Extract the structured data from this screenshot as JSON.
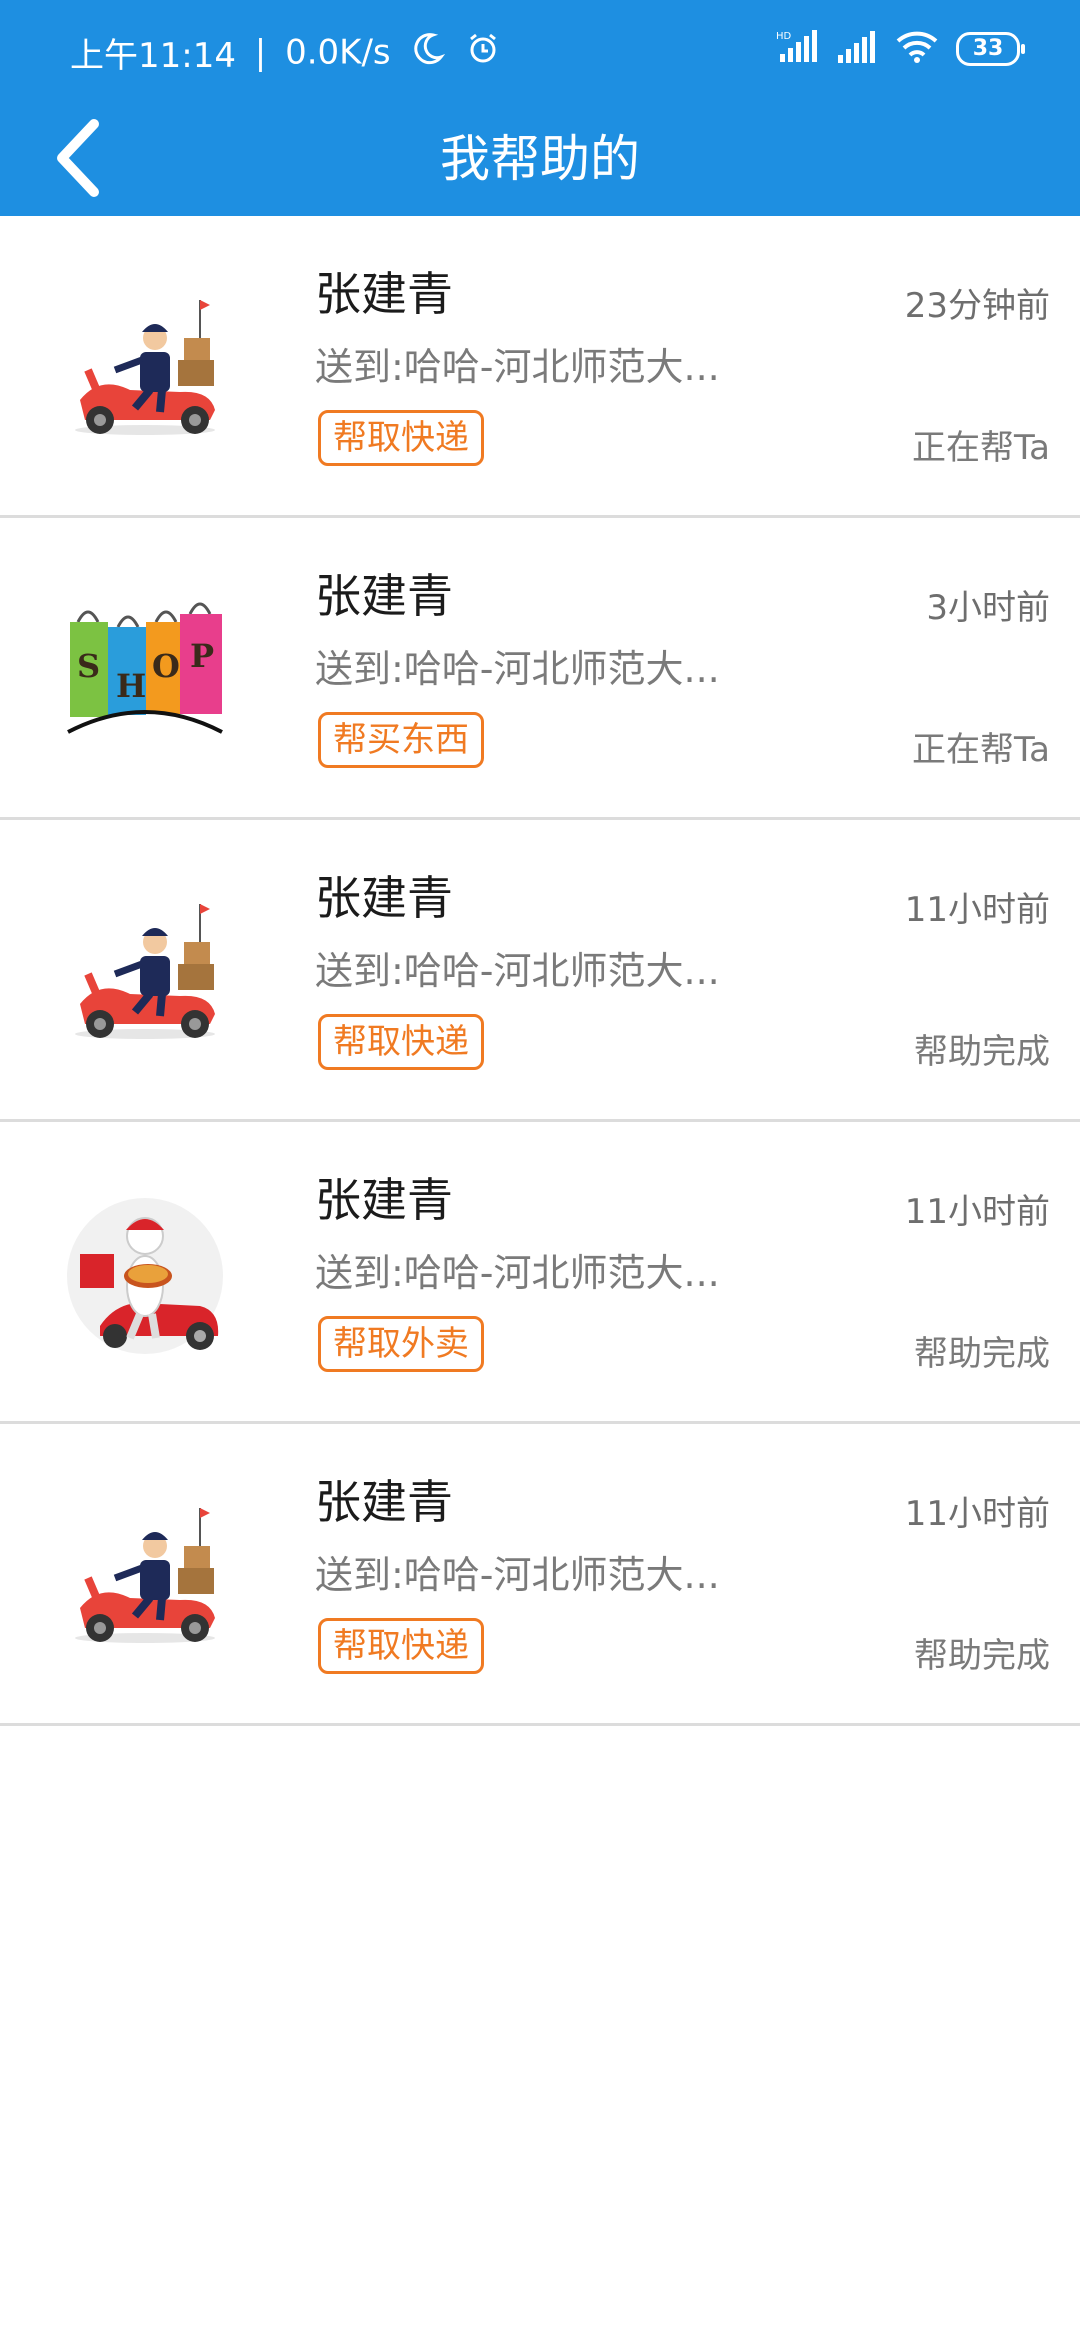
{
  "status_bar": {
    "time": "上午11:14",
    "separator": "|",
    "speed": "0.0K/s",
    "battery": "33",
    "icons": [
      "moon-icon",
      "alarm-icon",
      "hd-signal-icon",
      "signal-icon",
      "wifi-icon",
      "battery-icon"
    ]
  },
  "header": {
    "title": "我帮助的",
    "back_icon": "chevron-left-icon",
    "bg_color": "#1E8FE1"
  },
  "orders": [
    {
      "name": "张建青",
      "address": "送到:哈哈-河北师范大...",
      "tag": "帮取快递",
      "time": "23分钟前",
      "status": "正在帮Ta",
      "image": "courier-scooter-icon"
    },
    {
      "name": "张建青",
      "address": "送到:哈哈-河北师范大...",
      "tag": "帮买东西",
      "time": "3小时前",
      "status": "正在帮Ta",
      "image": "shop-bags-icon"
    },
    {
      "name": "张建青",
      "address": "送到:哈哈-河北师范大...",
      "tag": "帮取快递",
      "time": "11小时前",
      "status": "帮助完成",
      "image": "courier-scooter-icon"
    },
    {
      "name": "张建青",
      "address": "送到:哈哈-河北师范大...",
      "tag": "帮取外卖",
      "time": "11小时前",
      "status": "帮助完成",
      "image": "food-delivery-icon"
    },
    {
      "name": "张建青",
      "address": "送到:哈哈-河北师范大...",
      "tag": "帮取快递",
      "time": "11小时前",
      "status": "帮助完成",
      "image": "courier-scooter-icon"
    }
  ],
  "shop_letters": [
    "S",
    "H",
    "O",
    "P"
  ],
  "colors": {
    "accent": "#1E8FE1",
    "tag": "#F07A22"
  }
}
